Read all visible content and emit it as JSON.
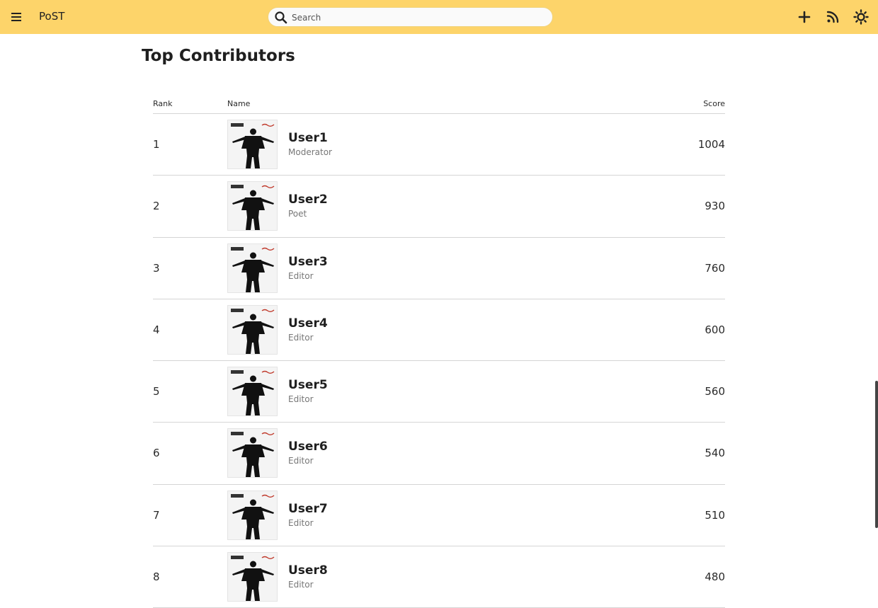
{
  "app": {
    "name": "PoST"
  },
  "search": {
    "placeholder": "Search"
  },
  "page": {
    "title": "Top Contributors"
  },
  "table": {
    "headers": {
      "rank": "Rank",
      "name": "Name",
      "score": "Score"
    },
    "rows": [
      {
        "rank": "1",
        "name": "User1",
        "role": "Moderator",
        "score": "1004"
      },
      {
        "rank": "2",
        "name": "User2",
        "role": "Poet",
        "score": "930"
      },
      {
        "rank": "3",
        "name": "User3",
        "role": "Editor",
        "score": "760"
      },
      {
        "rank": "4",
        "name": "User4",
        "role": "Editor",
        "score": "600"
      },
      {
        "rank": "5",
        "name": "User5",
        "role": "Editor",
        "score": "560"
      },
      {
        "rank": "6",
        "name": "User6",
        "role": "Editor",
        "score": "540"
      },
      {
        "rank": "7",
        "name": "User7",
        "role": "Editor",
        "score": "510"
      },
      {
        "rank": "8",
        "name": "User8",
        "role": "Editor",
        "score": "480"
      }
    ]
  },
  "colors": {
    "topbar": "#fdd46a",
    "text": "#1f1f1f",
    "muted": "#777777",
    "divider": "#d5d5d5"
  },
  "icons": {
    "menu": "menu-icon",
    "search": "search-icon",
    "add": "plus-icon",
    "feed": "rss-icon",
    "theme": "sun-icon",
    "avatar": "album-cover-avatar"
  }
}
